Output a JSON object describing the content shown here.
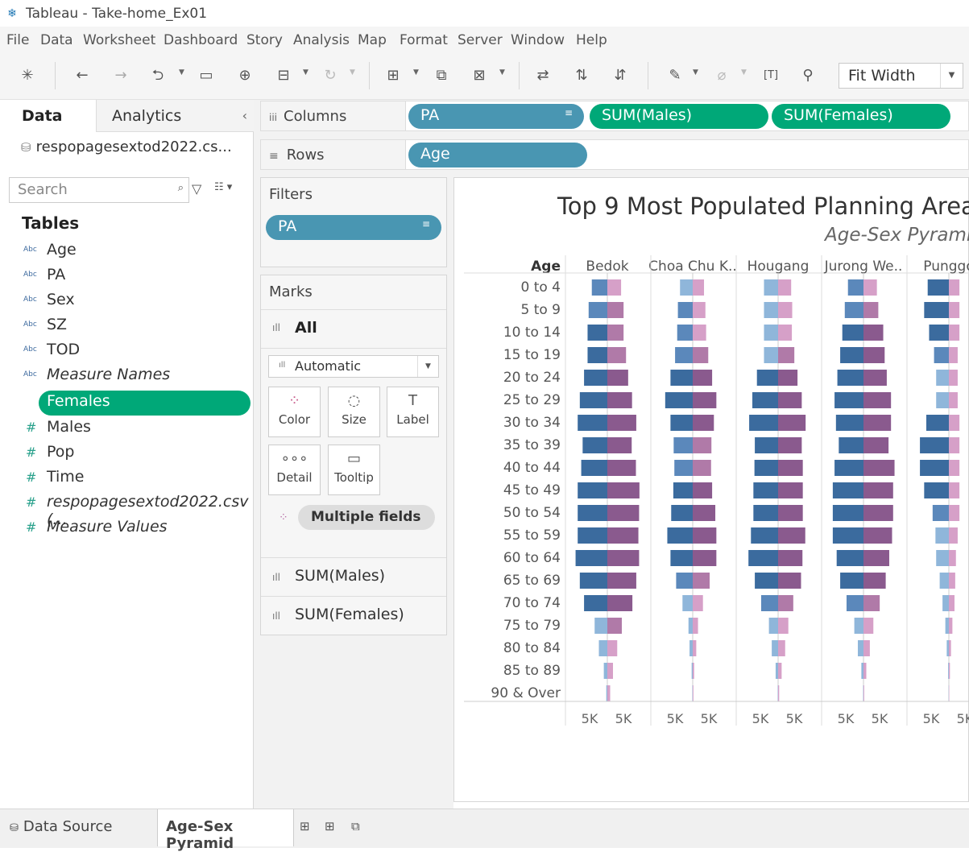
{
  "window": {
    "title": "Tableau - Take-home_Ex01"
  },
  "menu": [
    "File",
    "Data",
    "Worksheet",
    "Dashboard",
    "Story",
    "Analysis",
    "Map",
    "Format",
    "Server",
    "Window",
    "Help"
  ],
  "toolbar": {
    "fit_label": "Fit Width"
  },
  "left_pane": {
    "tab_data": "Data",
    "tab_analytics": "Analytics",
    "datasource_name": "respopagesextod2022.cs...",
    "search_placeholder": "Search",
    "tables_header": "Tables",
    "dimensions": [
      {
        "type": "Abc",
        "name": "Age"
      },
      {
        "type": "Abc",
        "name": "PA"
      },
      {
        "type": "Abc",
        "name": "Sex"
      },
      {
        "type": "Abc",
        "name": "SZ"
      },
      {
        "type": "Abc",
        "name": "TOD"
      },
      {
        "type": "Abc",
        "name": "Measure Names"
      }
    ],
    "measures": [
      {
        "type": "#",
        "name": "Females"
      },
      {
        "type": "#",
        "name": "Males"
      },
      {
        "type": "#",
        "name": "Pop"
      },
      {
        "type": "#",
        "name": "Time"
      },
      {
        "type": "#",
        "name": "respopagesextod2022.csv (..."
      },
      {
        "type": "#",
        "name": "Measure Values"
      }
    ]
  },
  "shelves": {
    "columns_label": "Columns",
    "rows_label": "Rows",
    "columns": [
      "PA",
      "SUM(Males)",
      "SUM(Females)"
    ],
    "rows": [
      "Age"
    ]
  },
  "filters": {
    "header": "Filters",
    "items": [
      "PA"
    ]
  },
  "marks": {
    "header": "Marks",
    "all_label": "All",
    "type": "Automatic",
    "buttons": [
      "Color",
      "Size",
      "Label",
      "Detail",
      "Tooltip"
    ],
    "multiple_fields": "Multiple fields",
    "sum_males": "SUM(Males)",
    "sum_females": "SUM(Females)"
  },
  "viz": {
    "title": "Top 9 Most Populated Planning Area",
    "subtitle": "Age-Sex Pyrami",
    "row_header": "Age",
    "pa_headers": [
      "Bedok",
      "Choa Chu K..",
      "Hougang",
      "Jurong We..",
      "Punggo"
    ],
    "axis_label": "5K"
  },
  "chart_data": {
    "type": "bar",
    "title": "Top 9 Most Populated Planning Area",
    "subtitle": "Age-Sex Pyrami",
    "categories": [
      "0 to 4",
      "5 to 9",
      "10 to 14",
      "15 to 19",
      "20 to 24",
      "25 to 29",
      "30 to 34",
      "35 to 39",
      "40 to 44",
      "45 to 49",
      "50 to 54",
      "55 to 59",
      "60 to 64",
      "65 to 69",
      "70 to 74",
      "75 to 79",
      "80 to 84",
      "85 to 89",
      "90 & Over"
    ],
    "xlabel": "5K",
    "panels": [
      {
        "pa": "Bedok",
        "males": [
          4400,
          5300,
          5600,
          5600,
          6600,
          7800,
          8400,
          7000,
          7400,
          8400,
          8400,
          8400,
          9000,
          7800,
          6600,
          3600,
          2400,
          1000,
          300
        ],
        "females": [
          3900,
          4600,
          4600,
          5300,
          5900,
          7000,
          8200,
          6900,
          8100,
          9100,
          9000,
          8800,
          9000,
          8200,
          7100,
          4100,
          2800,
          1600,
          800
        ]
      },
      {
        "pa": "Choa Chu K..",
        "males": [
          3600,
          4200,
          4400,
          5000,
          6300,
          7800,
          6300,
          5400,
          5200,
          5500,
          6100,
          7200,
          6300,
          4700,
          2900,
          1200,
          900,
          300,
          100
        ],
        "females": [
          3200,
          3600,
          3800,
          4400,
          5500,
          6700,
          6000,
          5300,
          5200,
          5500,
          6400,
          6700,
          6700,
          4800,
          2900,
          1500,
          1000,
          400,
          200
        ]
      },
      {
        "pa": "Hougang",
        "males": [
          4000,
          4000,
          4000,
          4000,
          6000,
          7300,
          8200,
          6600,
          6700,
          7000,
          7000,
          7700,
          8400,
          6600,
          4800,
          2600,
          1800,
          700,
          100
        ],
        "females": [
          3700,
          4000,
          3900,
          4600,
          5500,
          6700,
          7800,
          6700,
          7000,
          7000,
          7000,
          7700,
          6900,
          6500,
          4300,
          2900,
          2000,
          1000,
          300
        ]
      },
      {
        "pa": "Jurong We..",
        "males": [
          4400,
          5300,
          6000,
          6600,
          7400,
          8200,
          7800,
          7000,
          8200,
          8700,
          8700,
          8700,
          7600,
          6600,
          4800,
          2600,
          1600,
          600,
          100
        ],
        "females": [
          3800,
          4200,
          5600,
          6000,
          6600,
          7800,
          7800,
          7100,
          8800,
          8400,
          8400,
          8100,
          7300,
          6300,
          4600,
          2800,
          1800,
          800,
          200
        ]
      },
      {
        "pa": "Punggo",
        "males": [
          6000,
          7000,
          5600,
          4200,
          3600,
          3600,
          6400,
          8200,
          8200,
          7000,
          4600,
          3800,
          3600,
          2600,
          1800,
          1000,
          600,
          200,
          50
        ],
        "females": [
          3000,
          3000,
          3000,
          2500,
          2500,
          2500,
          3000,
          3000,
          3000,
          3000,
          3000,
          2500,
          2000,
          1800,
          1600,
          1000,
          600,
          300,
          100
        ]
      }
    ],
    "series": [
      {
        "name": "SUM(Males)"
      },
      {
        "name": "SUM(Females)"
      }
    ]
  },
  "bottom": {
    "data_source": "Data Source",
    "sheet": "Age-Sex Pyramid"
  },
  "colors": {
    "accent_green": "#00a878",
    "pill_blue": "#4996b2",
    "male_dark": "#3b6b9e",
    "male_light": "#9dc3e2",
    "female_dark": "#8a5a8e",
    "female_light": "#d6a0c8"
  }
}
